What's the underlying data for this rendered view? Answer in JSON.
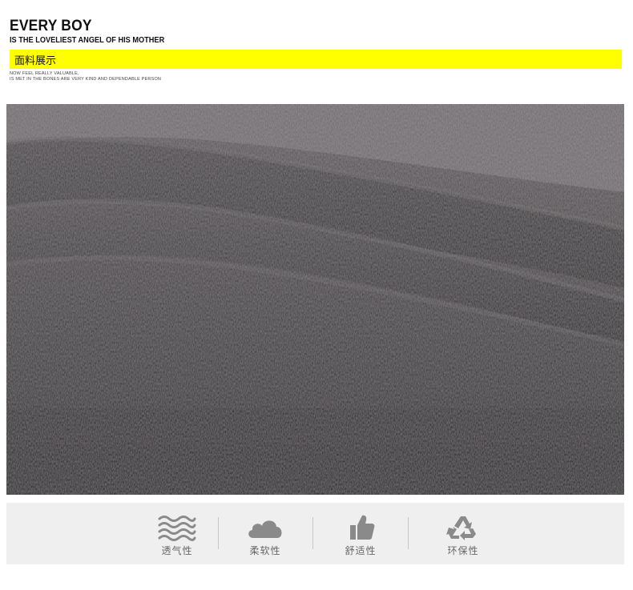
{
  "header": {
    "title": "EVERY BOY",
    "subtitle": "IS THE LOVELIEST ANGEL OF HIS MOTHER",
    "section_label": "面料展示",
    "tagline_line1": "NOW FEEL REALLY VALUABLE,",
    "tagline_line2": "IS MET IN THE BONES ARE VERY KIND AND DEPENDABLE PERSON",
    "accent_color": "#ffff00"
  },
  "fabric_image": {
    "subject": "dark grey knit fabric close-up"
  },
  "features": [
    {
      "label": "透气性",
      "icon": "waves-icon"
    },
    {
      "label": "柔软性",
      "icon": "cloud-icon"
    },
    {
      "label": "舒适性",
      "icon": "thumbs-up-icon"
    },
    {
      "label": "环保性",
      "icon": "recycle-icon"
    }
  ]
}
